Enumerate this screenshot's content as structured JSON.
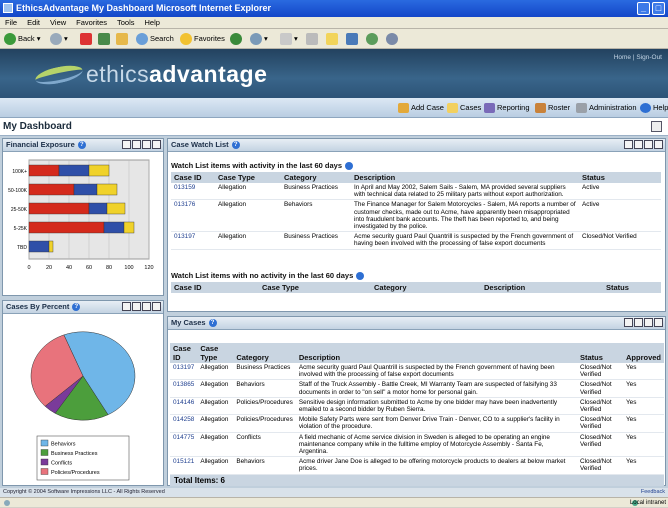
{
  "window": {
    "title": "EthicsAdvantage  My Dashboard  Microsoft Internet Explorer"
  },
  "menu": [
    "File",
    "Edit",
    "View",
    "Favorites",
    "Tools",
    "Help"
  ],
  "toolbar": {
    "back": "Back",
    "search": "Search",
    "favorites": "Favorites"
  },
  "banner": {
    "logo_a": "ethics",
    "logo_b": "advantage",
    "links": "Home | Sign-Out"
  },
  "nav": {
    "add_case": "Add Case",
    "cases": "Cases",
    "reporting": "Reporting",
    "roster": "Roster",
    "administration": "Administration",
    "help": "Help"
  },
  "page": {
    "title": "My Dashboard"
  },
  "financial": {
    "title": "Financial Exposure",
    "chart_data": {
      "type": "bar",
      "categories": [
        "100K+",
        "50-100K",
        "25-50K",
        "5-25K",
        "TBD"
      ],
      "series": [
        {
          "values": [
            30,
            45,
            60,
            75,
            0
          ]
        },
        {
          "values": [
            60,
            68,
            78,
            95,
            20
          ]
        },
        {
          "values": [
            80,
            88,
            96,
            105,
            24
          ]
        }
      ],
      "xticks": [
        "0",
        "20",
        "40",
        "60",
        "80",
        "100",
        "120"
      ],
      "xlim": [
        0,
        120
      ],
      "colors": [
        "#d42a1c",
        "#2f4fa8",
        "#f0d22a"
      ]
    }
  },
  "percent": {
    "title": "Cases By Percent",
    "chart_data": {
      "type": "pie",
      "labels": [
        "Behaviors",
        "Business Practices",
        "Conflicts",
        "Policies/Procedures"
      ],
      "values": [
        48,
        17,
        4,
        31
      ],
      "colors": [
        "#6fb6e8",
        "#4c9e3c",
        "#7a3b9a",
        "#e8737c"
      ]
    }
  },
  "watch": {
    "title": "Case Watch List",
    "active_heading": "Watch List items with activity in the last 60 days",
    "inactive_heading": "Watch List items with no activity in the last 60 days",
    "columns": [
      "Case ID",
      "Case Type",
      "Category",
      "Description",
      "Status"
    ],
    "rows": [
      {
        "id": "013159",
        "type": "Allegation",
        "category": "Business Practices",
        "desc": "In April and May 2002, Salem Sails - Salem, MA provided several suppliers with technical data related to 25 military parts without export authorization.",
        "status": "Active"
      },
      {
        "id": "013176",
        "type": "Allegation",
        "category": "Behaviors",
        "desc": "The Finance Manager for Salem Motorcycles - Salem, MA reports a number of customer checks, made out to Acme, have apparently been misappropriated into fraudulent bank accounts. The theft has been reported to, and being investigated by the police.",
        "status": "Active"
      },
      {
        "id": "013197",
        "type": "Allegation",
        "category": "Business Practices",
        "desc": "Acme security guard Paul Quantrill is suspected by the French government of having been involved with the processing of false export documents",
        "status": "Closed/Not Verified"
      }
    ]
  },
  "mycases": {
    "title": "My Cases",
    "columns": [
      "Case ID",
      "Case Type",
      "Category",
      "Description",
      "Status",
      "Approved"
    ],
    "rows": [
      {
        "id": "013197",
        "type": "Allegation",
        "category": "Business Practices",
        "desc": "Acme security guard Paul Quantrill is suspected by the French government of having been involved with the processing of false export documents",
        "status": "Closed/Not Verified",
        "approved": "Yes"
      },
      {
        "id": "013865",
        "type": "Allegation",
        "category": "Behaviors",
        "desc": "Staff of the Truck Assembly - Battle Creek, MI Warranty Team are suspected of falsifying 33 documents in order to \"on sell\" a motor home for personal gain.",
        "status": "Closed/Not Verified",
        "approved": "Yes"
      },
      {
        "id": "014146",
        "type": "Allegation",
        "category": "Policies/Procedures",
        "desc": "Sensitive design information submitted to Acme by one bidder may have been inadvertently emailed to a second bidder by Ruben Sierra.",
        "status": "Closed/Not Verified",
        "approved": "Yes"
      },
      {
        "id": "014258",
        "type": "Allegation",
        "category": "Policies/Procedures",
        "desc": "Mobile Safety Parts were sent from Denver Drive Train - Denver, CO to a supplier's facility in violation of the procedure.",
        "status": "Closed/Not Verified",
        "approved": "Yes"
      },
      {
        "id": "014775",
        "type": "Allegation",
        "category": "Conflicts",
        "desc": "A field mechanic of Acme service division in Sweden is alleged to be operating an engine maintenance company while in the fulltime employ of Motorcycle Assembly - Santa Fe, Argentina.",
        "status": "Closed/Not Verified",
        "approved": "Yes"
      },
      {
        "id": "015121",
        "type": "Allegation",
        "category": "Behaviors",
        "desc": "Acme driver Jane Doe is alleged to be offering motorcycle products to dealers at below market prices.",
        "status": "Closed/Not Verified",
        "approved": "Yes"
      }
    ],
    "total": "Total Items: 6"
  },
  "footer": {
    "copyright": "Copyright © 2004 Software Impressions LLC - All Rights Reserved",
    "feedback": "Feedback",
    "zone": "Local intranet"
  }
}
